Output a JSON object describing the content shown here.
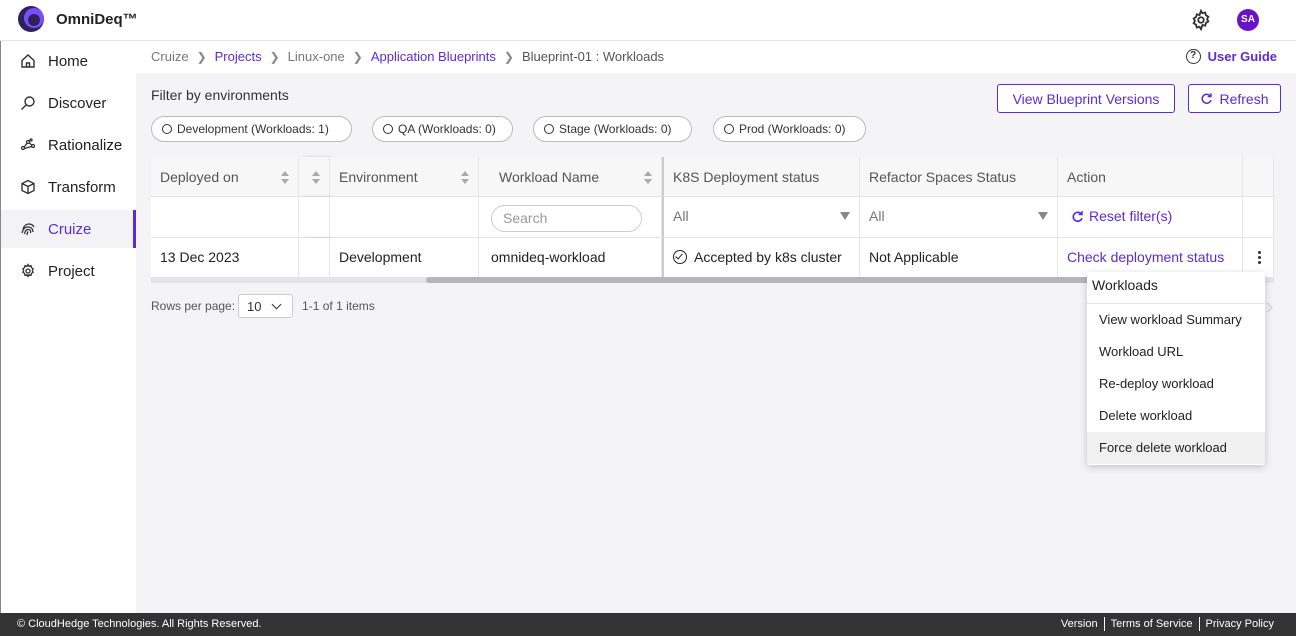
{
  "header": {
    "brand": "OmniDeq™",
    "avatar_initials": "SA"
  },
  "sidebar": {
    "items": [
      {
        "label": "Home",
        "icon": "home-icon"
      },
      {
        "label": "Discover",
        "icon": "search-icon"
      },
      {
        "label": "Rationalize",
        "icon": "rationalize-icon"
      },
      {
        "label": "Transform",
        "icon": "cube-icon"
      },
      {
        "label": "Cruize",
        "icon": "fingerprint-icon",
        "active": true
      },
      {
        "label": "Project",
        "icon": "gear-icon"
      }
    ]
  },
  "breadcrumb": {
    "items": [
      "Cruize",
      "Projects",
      "Linux-one",
      "Application Blueprints",
      "Blueprint-01 : Workloads"
    ]
  },
  "user_guide": "User Guide",
  "filters": {
    "title": "Filter by environments",
    "chips": [
      "Development (Workloads: 1)",
      "QA (Workloads: 0)",
      "Stage (Workloads: 0)",
      "Prod (Workloads: 0)"
    ]
  },
  "buttons": {
    "view_versions": "View Blueprint Versions",
    "refresh": "Refresh"
  },
  "table": {
    "columns": [
      "Deployed on",
      "Environment",
      "Workload Name",
      "K8S Deployment status",
      "Refactor Spaces Status",
      "Action"
    ],
    "filter_row": {
      "search_placeholder": "Search",
      "k8s_filter": "All",
      "refactor_filter": "All",
      "reset": "Reset filter(s)"
    },
    "rows": [
      {
        "deployed_on": "13 Dec 2023",
        "environment": "Development",
        "workload_name": "omnideq-workload",
        "k8s_status": "Accepted by k8s cluster",
        "refactor_status": "Not Applicable",
        "action": "Check deployment status"
      }
    ]
  },
  "pager": {
    "label": "Rows per page:",
    "size": "10",
    "count": "1-1 of 1 items"
  },
  "menu": {
    "title": "Workloads",
    "items": [
      "View workload Summary",
      "Workload URL",
      "Re-deploy workload",
      "Delete workload",
      "Force delete workload"
    ]
  },
  "footer": {
    "copyright": "© CloudHedge Technologies. All Rights Reserved.",
    "links": [
      "Version",
      "Terms of Service",
      "Privacy Policy"
    ]
  },
  "colors": {
    "accent": "#5b2bd6",
    "footer": "#333333"
  }
}
